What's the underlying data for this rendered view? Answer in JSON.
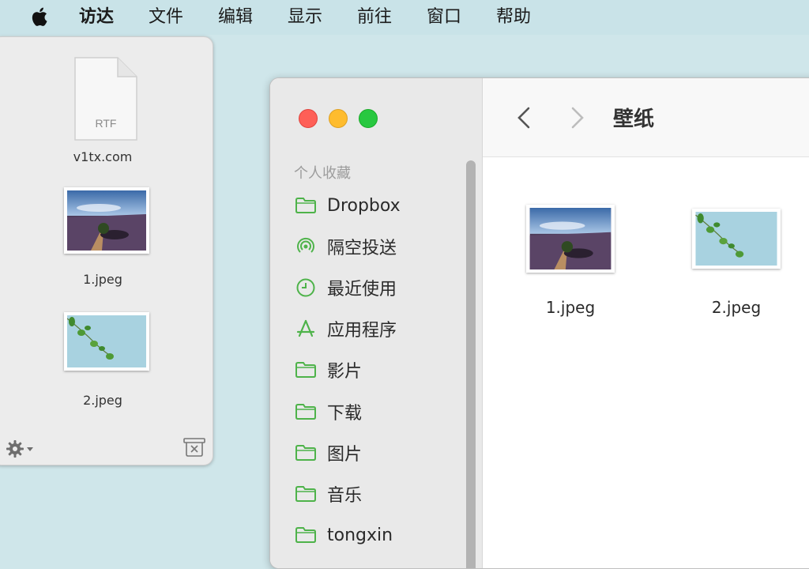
{
  "menubar": {
    "app_name": "访达",
    "items": [
      "文件",
      "编辑",
      "显示",
      "前往",
      "窗口",
      "帮助"
    ]
  },
  "stack": {
    "files": [
      {
        "name": "v1tx.com",
        "kind": "RTF"
      },
      {
        "name": "1.jpeg"
      },
      {
        "name": "2.jpeg"
      }
    ]
  },
  "finder": {
    "sidebar": {
      "section": "个人收藏",
      "items": [
        {
          "label": "Dropbox",
          "icon": "folder-icon"
        },
        {
          "label": "隔空投送",
          "icon": "airdrop-icon"
        },
        {
          "label": "最近使用",
          "icon": "clock-icon"
        },
        {
          "label": "应用程序",
          "icon": "applications-icon"
        },
        {
          "label": "影片",
          "icon": "folder-icon"
        },
        {
          "label": "下载",
          "icon": "folder-icon"
        },
        {
          "label": "图片",
          "icon": "folder-icon"
        },
        {
          "label": "音乐",
          "icon": "folder-icon"
        },
        {
          "label": "tongxin",
          "icon": "folder-icon"
        }
      ]
    },
    "title": "壁纸",
    "files": [
      {
        "name": "1.jpeg"
      },
      {
        "name": "2.jpeg"
      }
    ]
  },
  "colors": {
    "accent_green": "#4eb34a",
    "desktop": "#cfe6ea"
  }
}
